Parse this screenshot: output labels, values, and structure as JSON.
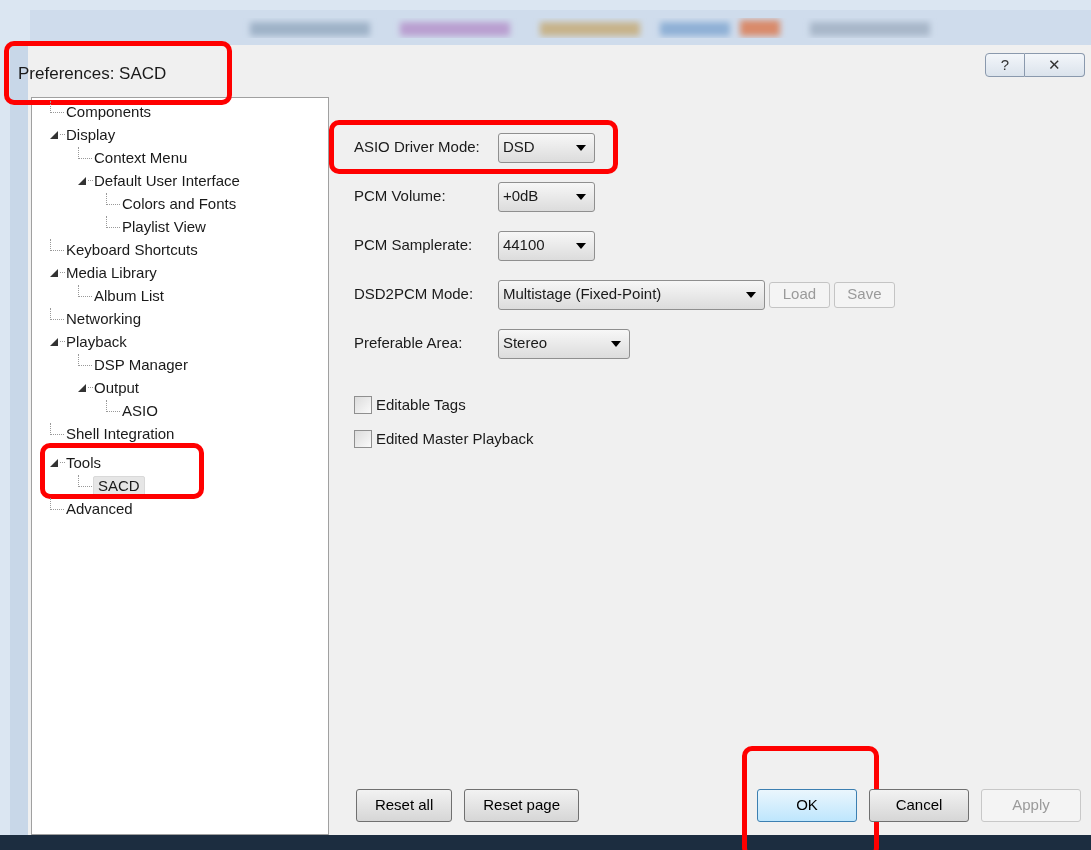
{
  "window": {
    "title": "Preferences: SACD",
    "title_highlighted": true,
    "title_buttons": [
      {
        "kind": "help",
        "label": "?"
      },
      {
        "kind": "close",
        "label": "✕"
      }
    ]
  },
  "tree": [
    {
      "label": "Components",
      "selected": false
    },
    {
      "label": "Display",
      "selected": false,
      "expanded": true,
      "children": [
        {
          "label": "Context Menu",
          "selected": false
        },
        {
          "label": "Default User Interface",
          "selected": false,
          "expanded": true,
          "children": [
            {
              "label": "Colors and Fonts",
              "selected": false
            },
            {
              "label": "Playlist View",
              "selected": false
            }
          ]
        }
      ]
    },
    {
      "label": "Keyboard Shortcuts",
      "selected": false
    },
    {
      "label": "Media Library",
      "selected": false,
      "expanded": true,
      "children": [
        {
          "label": "Album List",
          "selected": false
        }
      ]
    },
    {
      "label": "Networking",
      "selected": false
    },
    {
      "label": "Playback",
      "selected": false,
      "expanded": true,
      "children": [
        {
          "label": "DSP Manager",
          "selected": false
        },
        {
          "label": "Output",
          "selected": false,
          "expanded": true,
          "children": [
            {
              "label": "ASIO",
              "selected": false
            }
          ]
        }
      ]
    },
    {
      "label": "Shell Integration",
      "selected": false
    },
    {
      "label": "Tools",
      "selected": false,
      "expanded": true,
      "highlighted": true,
      "children": [
        {
          "label": "SACD",
          "selected": true
        }
      ]
    },
    {
      "label": "Advanced",
      "selected": false
    }
  ],
  "settings": [
    {
      "kind": "dropdown",
      "label": "ASIO Driver Mode:",
      "value": "DSD",
      "highlighted": true
    },
    {
      "kind": "dropdown",
      "label": "PCM Volume:",
      "value": "+0dB"
    },
    {
      "kind": "dropdown",
      "label": "PCM Samplerate:",
      "value": "44100"
    },
    {
      "kind": "dropdown",
      "label": "DSD2PCM Mode:",
      "value": "Multistage (Fixed-Point)",
      "wide": true,
      "buttons": [
        {
          "label": "Load",
          "disabled": true
        },
        {
          "label": "Save",
          "disabled": true
        }
      ]
    },
    {
      "kind": "dropdown",
      "label": "Preferable Area:",
      "value": "Stereo",
      "medium": true
    },
    {
      "kind": "checkbox",
      "label": "Editable Tags",
      "checked": false
    },
    {
      "kind": "checkbox",
      "label": "Edited Master Playback",
      "checked": false
    }
  ],
  "footer_buttons": [
    {
      "label": "Reset all",
      "disabled": false,
      "default": false
    },
    {
      "label": "Reset page",
      "disabled": false,
      "default": false
    },
    {
      "label": "OK",
      "disabled": false,
      "default": true,
      "highlighted": true
    },
    {
      "label": "Cancel",
      "disabled": false,
      "default": false
    },
    {
      "label": "Apply",
      "disabled": true,
      "default": false
    }
  ]
}
